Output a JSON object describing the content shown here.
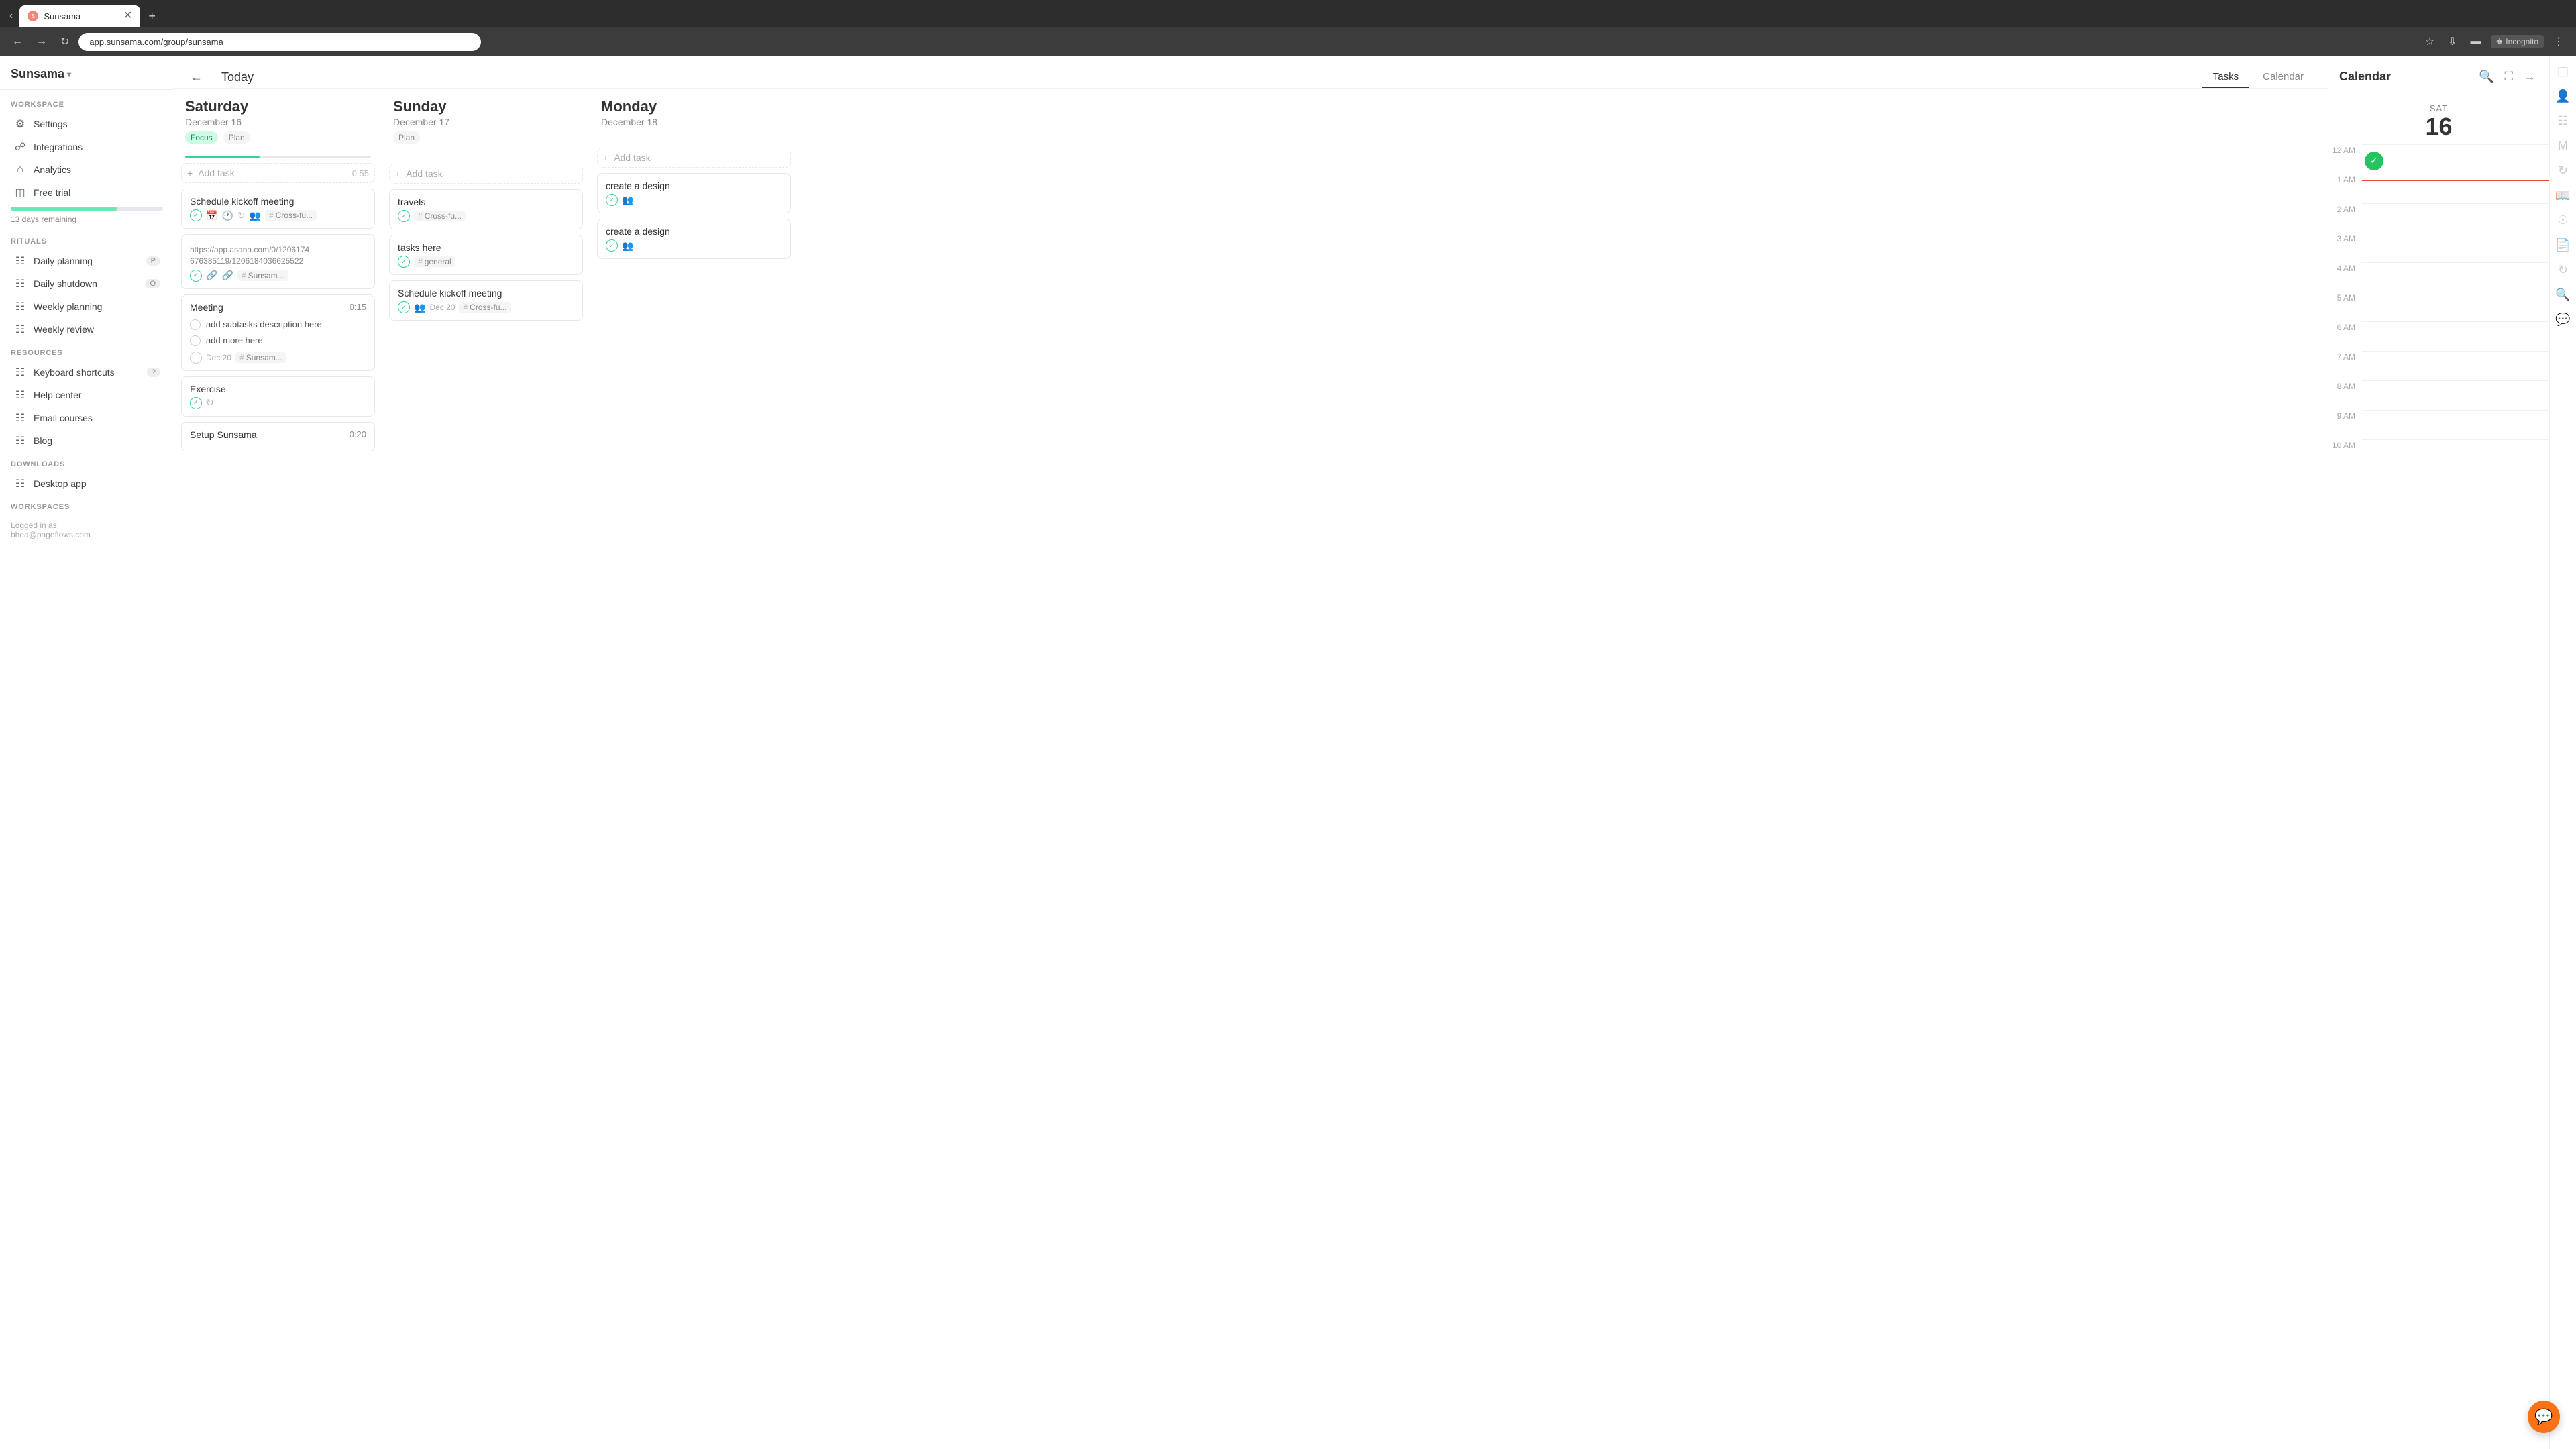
{
  "browser": {
    "tab_label": "Sunsama",
    "url": "app.sunsama.com/group/sunsama",
    "incognito_label": "Incognito"
  },
  "sidebar": {
    "logo": "Sunsama",
    "workspace_section": "WORKSPACE",
    "settings_label": "Settings",
    "integrations_label": "Integrations",
    "analytics_label": "Analytics",
    "free_trial_label": "Free trial",
    "trial_days": "13 days remaining",
    "rituals_section": "RITUALS",
    "daily_planning_label": "Daily planning",
    "daily_planning_badge": "P",
    "daily_shutdown_label": "Daily shutdown",
    "daily_shutdown_badge": "O",
    "weekly_planning_label": "Weekly planning",
    "weekly_review_label": "Weekly review",
    "resources_section": "RESOURCES",
    "keyboard_shortcuts_label": "Keyboard shortcuts",
    "help_center_label": "Help center",
    "email_courses_label": "Email courses",
    "blog_label": "Blog",
    "downloads_section": "DOWNLOADS",
    "desktop_app_label": "Desktop app",
    "workspaces_section": "WORKSPACES",
    "logged_in_as": "Logged in as",
    "user_email": "bhea@pageflows.com"
  },
  "header": {
    "today_label": "Today",
    "tasks_tab": "Tasks",
    "calendar_tab": "Calendar"
  },
  "days": [
    {
      "name": "Saturday",
      "date": "December 16",
      "badges": [
        "Focus",
        "Plan"
      ],
      "has_progress": true,
      "add_task_placeholder": "Add task",
      "add_task_time": "0:55",
      "tasks": [
        {
          "id": "sat-1",
          "title": "Schedule kickoff meeting",
          "has_check": true,
          "icons": [
            "check",
            "calendar",
            "clock",
            "repeat",
            "people"
          ],
          "tag": "Cross-fu...",
          "time": ""
        },
        {
          "id": "sat-2",
          "title": "https://app.asana.com/0/12061746763851",
          "url_line2": "19/1206184036625522",
          "has_check": true,
          "icons": [
            "check",
            "link",
            "link2"
          ],
          "tag": "Sunsam...",
          "time": ""
        },
        {
          "id": "sat-3",
          "title": "Meeting",
          "time": "0:15",
          "subtasks": [
            "add subtasks description here",
            "add more here"
          ],
          "date_label": "Dec 20",
          "tag": "Sunsam..."
        },
        {
          "id": "sat-4",
          "title": "Exercise",
          "has_check": true,
          "icons": [
            "check",
            "repeat"
          ]
        },
        {
          "id": "sat-5",
          "title": "Setup Sunsama",
          "time": "0:20"
        }
      ]
    },
    {
      "name": "Sunday",
      "date": "December 17",
      "badges": [
        "Plan"
      ],
      "has_progress": false,
      "tasks": [
        {
          "id": "sun-1",
          "title": "travels",
          "has_check": true,
          "tag": "Cross-fu..."
        },
        {
          "id": "sun-2",
          "title": "tasks here",
          "has_check": true,
          "tag": "general"
        },
        {
          "id": "sun-3",
          "title": "Schedule kickoff meeting",
          "has_check": true,
          "date_label": "Dec 20",
          "tag": "Cross-fu...",
          "icons": [
            "people"
          ]
        }
      ]
    },
    {
      "name": "Monday",
      "date": "December 18",
      "badges": [],
      "has_progress": false,
      "tasks": [
        {
          "id": "mon-1",
          "title": "create a design",
          "has_check": true,
          "icons": [
            "people"
          ]
        },
        {
          "id": "mon-2",
          "title": "create a design",
          "has_check": true,
          "icons": [
            "people"
          ]
        }
      ]
    }
  ],
  "calendar_panel": {
    "title": "Calendar",
    "day_name": "SAT",
    "day_number": "16",
    "time_slots": [
      "12 AM",
      "1 AM",
      "2 AM",
      "3 AM",
      "4 AM",
      "5 AM",
      "6 AM",
      "7 AM",
      "8 AM",
      "9 AM",
      "10 AM"
    ]
  },
  "fab": {
    "chat_icon": "💬",
    "add_icon": "+"
  }
}
